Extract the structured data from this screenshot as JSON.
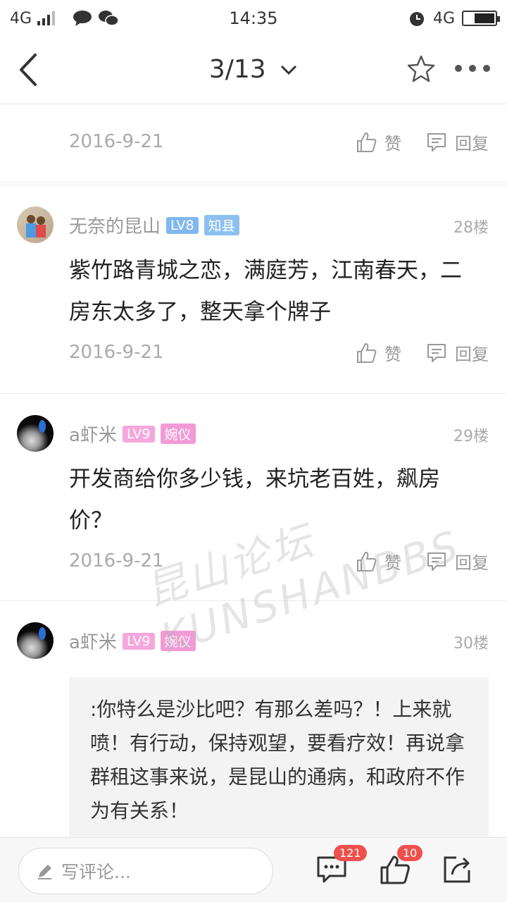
{
  "statusbar": {
    "network_left": "4G",
    "time": "14:35",
    "network_right": "4G"
  },
  "navbar": {
    "title": "3/13"
  },
  "actions": {
    "like_label": "赞",
    "reply_label": "回复"
  },
  "partial": {
    "date": "2016-9-21"
  },
  "posts": [
    {
      "username": "无奈的昆山",
      "level": "LV8",
      "title": "知县",
      "floor": "28楼",
      "text": "紫竹路青城之恋，满庭芳，江南春天，二房东太多了，整天拿个牌子",
      "date": "2016-9-21"
    },
    {
      "username": "a虾米",
      "level": "LV9",
      "title": "婉仪",
      "floor": "29楼",
      "text": "开发商给你多少钱，来坑老百姓，飙房价？",
      "date": "2016-9-21"
    },
    {
      "username": "a虾米",
      "level": "LV9",
      "title": "婉仪",
      "floor": "30楼",
      "quote": ":你特么是沙比吧？有那么差吗？！上来就喷！有行动，保持观望，要看疗效！再说拿群租这事来说，是昆山的通病，和政府不作为有关系！"
    }
  ],
  "watermark": "昆山论坛 KUNSHANBBS",
  "bottombar": {
    "placeholder": "写评论...",
    "comment_count": "121",
    "like_count": "10"
  },
  "colors": {
    "lv8": "#7fb8ef",
    "title_blue": "#8cc0ef",
    "lv9": "#f5a7dc",
    "title_pink": "#f29ad6",
    "badge_red": "#f0504d"
  }
}
